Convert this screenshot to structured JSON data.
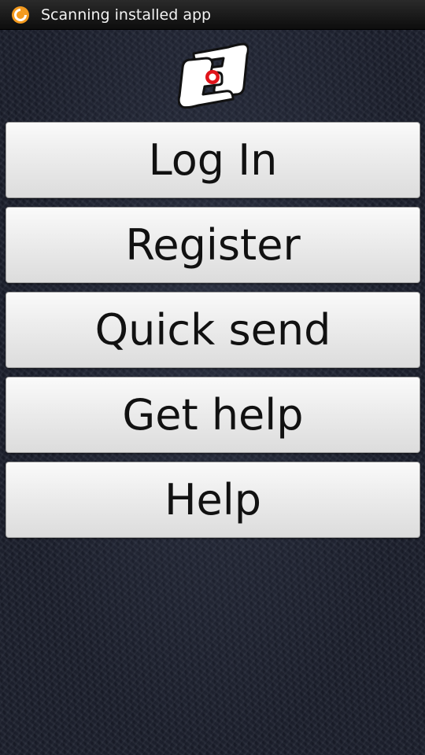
{
  "status_bar": {
    "notification_text": "Scanning installed app",
    "notification_icon": "app-scanner-icon",
    "icon_color": "#f39a1e"
  },
  "logo": {
    "icon": "hands-frame-logo-icon",
    "accent_color": "#e0141b"
  },
  "menu": {
    "buttons": [
      {
        "label": "Log In"
      },
      {
        "label": "Register"
      },
      {
        "label": "Quick send"
      },
      {
        "label": "Get help"
      },
      {
        "label": "Help"
      }
    ]
  }
}
